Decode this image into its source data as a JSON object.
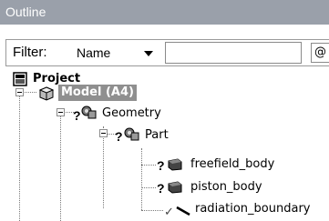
{
  "panel": {
    "title": "Outline"
  },
  "filter": {
    "label": "Filter:",
    "selected": "Name",
    "input_value": "",
    "extra_glyph": "@"
  },
  "tree": {
    "project": {
      "label": "Project",
      "icon": "project-icon"
    },
    "model": {
      "label": "Model (A4)",
      "icon": "model-icon",
      "selected": true
    },
    "geometry": {
      "label": "Geometry",
      "icon": "geometry-icon",
      "status": "?"
    },
    "part": {
      "label": "Part",
      "icon": "part-icon",
      "status": "?"
    },
    "bodies": [
      {
        "label": "freefield_body",
        "icon": "body-icon",
        "status": "?"
      },
      {
        "label": "piston_body",
        "icon": "body-icon",
        "status": "?"
      },
      {
        "label": "radiation_boundary",
        "icon": "boundary-icon",
        "status": "✓"
      }
    ]
  },
  "colors": {
    "titlebar": "#9aa0aa",
    "selection": "#8f8f8f"
  }
}
